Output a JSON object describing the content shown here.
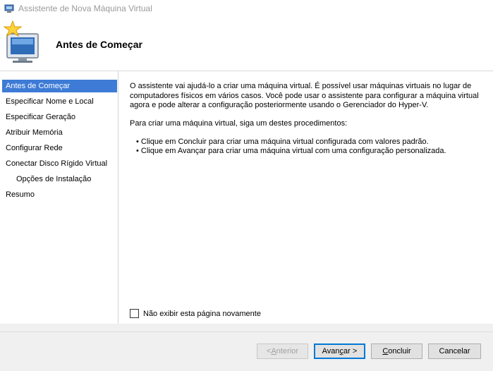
{
  "window": {
    "title": "Assistente de Nova Máquina Virtual"
  },
  "header": {
    "heading": "Antes de Começar"
  },
  "sidebar": {
    "items": [
      {
        "label": "Antes de Começar"
      },
      {
        "label": "Especificar Nome e Local"
      },
      {
        "label": "Especificar Geração"
      },
      {
        "label": "Atribuir Memória"
      },
      {
        "label": "Configurar Rede"
      },
      {
        "label": "Conectar Disco Rígido Virtual"
      },
      {
        "label": "Opções de Instalação"
      },
      {
        "label": "Resumo"
      }
    ]
  },
  "content": {
    "intro_lines": [
      "O assistente vai ajudá-lo a criar uma máquina virtual. É possível usar máquinas virtuais no lugar de",
      "computadores físicos em vários casos. Você pode usar o assistente para configurar a máquina virtual",
      "agora e pode alterar a configuração posteriormente usando o Gerenciador do Hyper-V."
    ],
    "procedures_intro": "Para criar uma máquina virtual, siga um destes procedimentos:",
    "bullets": [
      "• Clique em Concluir para criar uma máquina virtual configurada com valores padrão.",
      "• Clique em Avançar para criar uma máquina virtual com uma configuração personalizada."
    ],
    "checkbox_label": "Não exibir esta página novamente"
  },
  "buttons": {
    "previous": {
      "prefix": "< ",
      "mnemonic": "A",
      "rest": "nterior"
    },
    "next": {
      "prefix": "Avan",
      "mnemonic": "ç",
      "rest": "ar >"
    },
    "finish": {
      "prefix": "",
      "mnemonic": "C",
      "rest": "oncluir"
    },
    "cancel": {
      "label": "Cancelar"
    }
  },
  "colors": {
    "selection": "#3d7bd6",
    "default_button_border": "#0078d7"
  }
}
